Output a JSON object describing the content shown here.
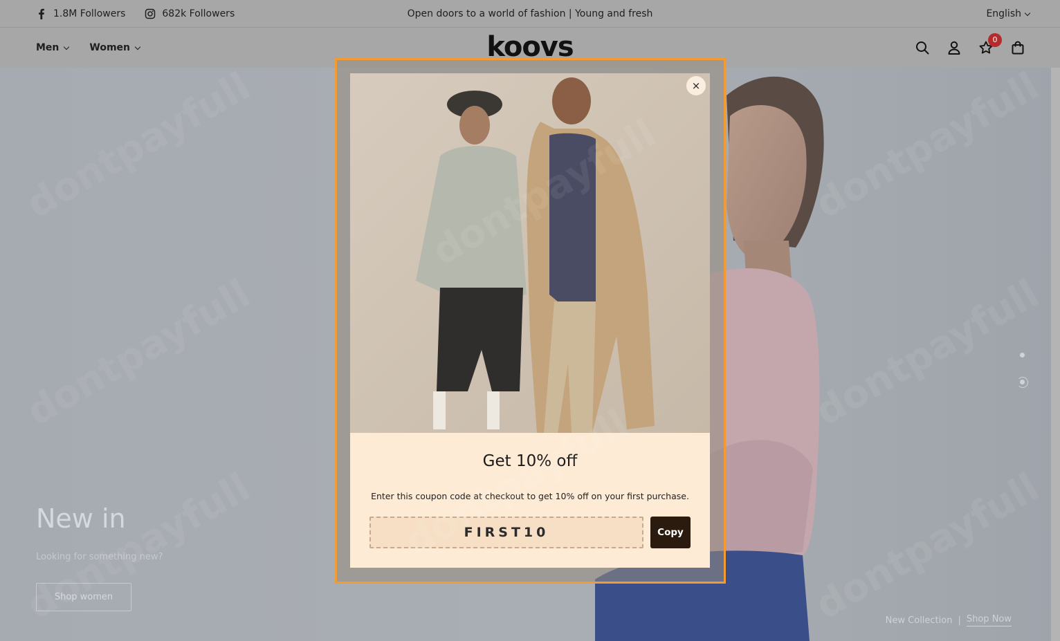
{
  "topbar": {
    "facebook": {
      "icon": "facebook-icon",
      "label": "1.8M Followers"
    },
    "instagram": {
      "icon": "instagram-icon",
      "label": "682k Followers"
    },
    "announcement": "Open doors to a world of fashion | Young and fresh",
    "language": "English"
  },
  "header": {
    "logo": "koovs",
    "nav": [
      {
        "label": "Men"
      },
      {
        "label": "Women"
      }
    ],
    "wishlist_count": "0"
  },
  "hero": {
    "title": "New in",
    "subtitle": "Looking for something new?",
    "button": "Shop women",
    "collection_label": "New Collection",
    "separator": "|",
    "shop_now": "Shop Now"
  },
  "popup": {
    "title": "Get 10% off",
    "description": "Enter this coupon code at checkout to get 10% off on your first purchase.",
    "coupon_code": "FIRST10",
    "copy_label": "Copy",
    "close_symbol": "×"
  },
  "colors": {
    "popup_highlight": "#f29a33",
    "popup_bg": "#fdebd7",
    "copy_button": "#2b1a0e",
    "badge": "#b52b2b"
  }
}
